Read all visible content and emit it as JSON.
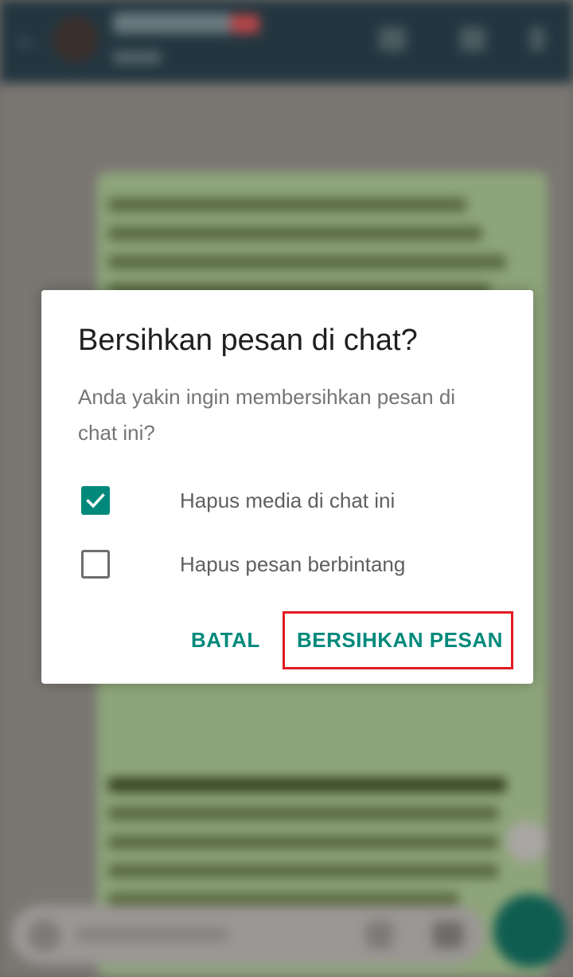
{
  "dialog": {
    "title": "Bersihkan pesan di chat?",
    "message": "Anda yakin ingin membersihkan pesan di chat ini?",
    "options": [
      {
        "label": "Hapus media di chat ini",
        "checked": true
      },
      {
        "label": "Hapus pesan berbintang",
        "checked": false
      }
    ],
    "cancel_label": "BATAL",
    "confirm_label": "BERSIHKAN PESAN"
  },
  "colors": {
    "accent": "#00897b",
    "highlight": "#e01b22",
    "app_bar": "#233640",
    "chat_bubble": "#8ea57a"
  },
  "icons": {
    "checked": "check-icon",
    "highlight": "annotation-box"
  }
}
